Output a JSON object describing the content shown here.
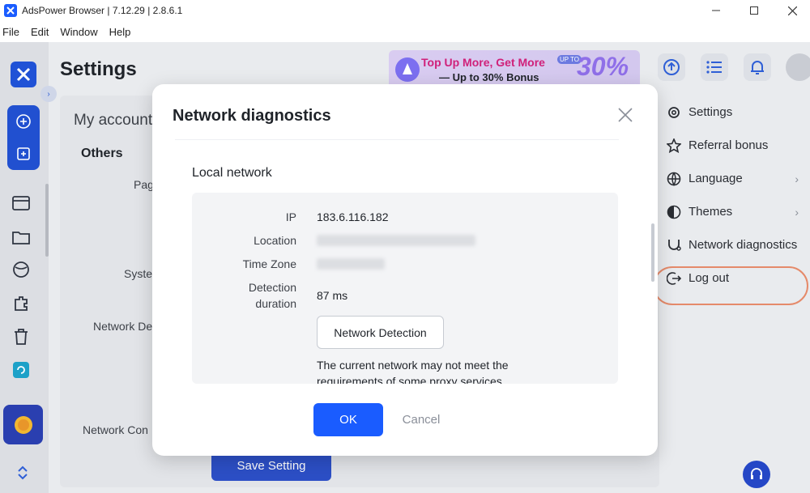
{
  "window": {
    "title": "AdsPower Browser | 7.12.29 | 2.8.6.1",
    "minimize_icon": "minimize-icon",
    "maximize_icon": "maximize-icon",
    "close_icon": "close-icon"
  },
  "menu": [
    "File",
    "Edit",
    "Window",
    "Help"
  ],
  "page": {
    "title": "Settings",
    "tab": "My account",
    "section": "Others",
    "labels": [
      "Pag",
      "Syste",
      "Network De",
      "Network Con"
    ],
    "save_label": "Save Setting"
  },
  "promo": {
    "line1": "Top Up More, Get More",
    "line2": "— Up to 30% Bonus",
    "big": "30%",
    "badge": "UP TO"
  },
  "dropdown": {
    "items": [
      {
        "label": "Settings",
        "icon": "gear-icon"
      },
      {
        "label": "Referral bonus",
        "icon": "star-icon"
      },
      {
        "label": "Language",
        "icon": "globe-icon",
        "chevron": "›"
      },
      {
        "label": "Themes",
        "icon": "theme-icon",
        "chevron": "›"
      },
      {
        "label": "Network diagnostics",
        "icon": "network-diagnostics-icon"
      },
      {
        "label": "Log out",
        "icon": "logout-icon"
      }
    ]
  },
  "modal": {
    "title": "Network diagnostics",
    "section_title": "Local network",
    "fields": {
      "ip_label": "IP",
      "ip_value": "183.6.116.182",
      "location_label": "Location",
      "timezone_label": "Time Zone",
      "detection_label_1": "Detection",
      "detection_label_2": "duration",
      "detection_value": "87 ms"
    },
    "detect_button": "Network Detection",
    "warning_1": "The current network may not meet the",
    "warning_2": "requirements of some proxy services.",
    "ok": "OK",
    "cancel": "Cancel"
  },
  "colors": {
    "accent": "#1a5cff",
    "highlight_ring": "#e58a6a"
  }
}
